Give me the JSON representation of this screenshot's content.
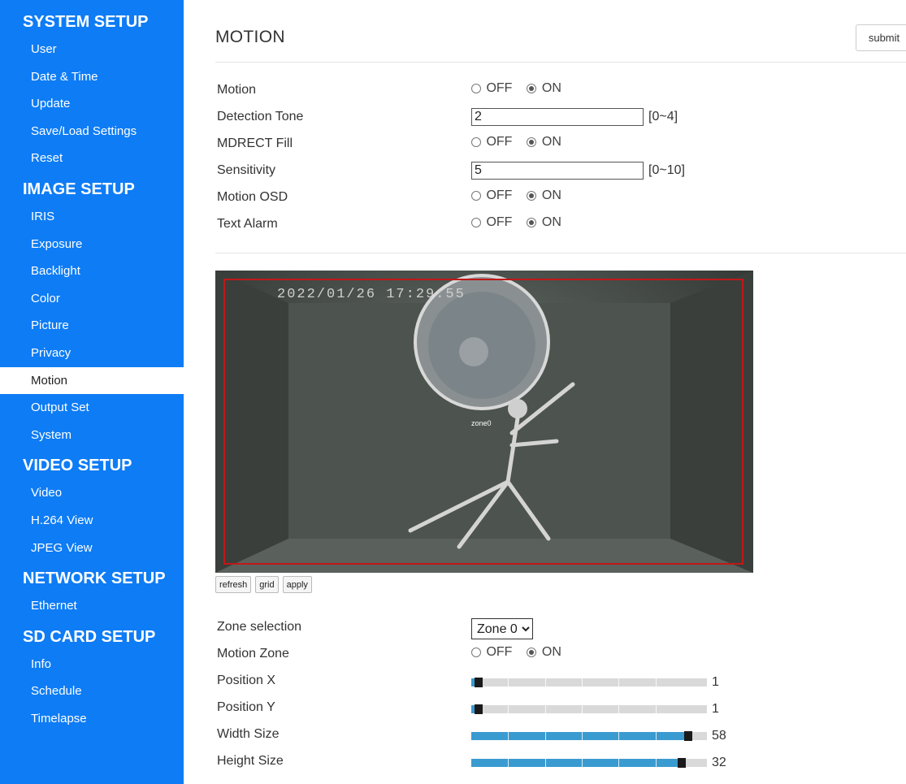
{
  "sidebar": {
    "sections": [
      {
        "title": "SYSTEM SETUP",
        "items": [
          "User",
          "Date & Time",
          "Update",
          "Save/Load Settings",
          "Reset"
        ]
      },
      {
        "title": "IMAGE SETUP",
        "items": [
          "IRIS",
          "Exposure",
          "Backlight",
          "Color",
          "Picture",
          "Privacy",
          "Motion",
          "Output Set",
          "System"
        ]
      },
      {
        "title": "VIDEO SETUP",
        "items": [
          "Video",
          "H.264 View",
          "JPEG View"
        ]
      },
      {
        "title": "NETWORK SETUP",
        "items": [
          "Ethernet"
        ]
      },
      {
        "title": "SD CARD SETUP",
        "items": [
          "Info",
          "Schedule",
          "Timelapse"
        ]
      }
    ],
    "active_item": "Motion"
  },
  "page": {
    "title": "MOTION",
    "submit_label": "submit"
  },
  "radio": {
    "off": "OFF",
    "on": "ON"
  },
  "settings": {
    "motion": {
      "label": "Motion",
      "value": "ON"
    },
    "detection_tone": {
      "label": "Detection Tone",
      "value": "2",
      "range": "[0~4]"
    },
    "mdrect_fill": {
      "label": "MDRECT Fill",
      "value": "ON"
    },
    "sensitivity": {
      "label": "Sensitivity",
      "value": "5",
      "range": "[0~10]"
    },
    "motion_osd": {
      "label": "Motion OSD",
      "value": "ON"
    },
    "text_alarm": {
      "label": "Text Alarm",
      "value": "ON"
    }
  },
  "camera": {
    "timestamp": "2022/01/26 17:29:55",
    "zone_label": "zone0",
    "buttons": {
      "refresh": "refresh",
      "grid": "grid",
      "apply": "apply"
    }
  },
  "zone": {
    "selection_label": "Zone selection",
    "selected": "Zone 0",
    "motion_zone": {
      "label": "Motion Zone",
      "value": "ON"
    },
    "position_x": {
      "label": "Position X",
      "value": "1",
      "fraction": 0.02
    },
    "position_y": {
      "label": "Position Y",
      "value": "1",
      "fraction": 0.02
    },
    "width_size": {
      "label": "Width Size",
      "value": "58",
      "fraction": 0.95
    },
    "height_size": {
      "label": "Height Size",
      "value": "32",
      "fraction": 0.92
    }
  },
  "colors": {
    "sidebar_bg": "#0e7cf5",
    "slider_fill": "#3a9bd1",
    "zone_rect": "#c01818"
  }
}
